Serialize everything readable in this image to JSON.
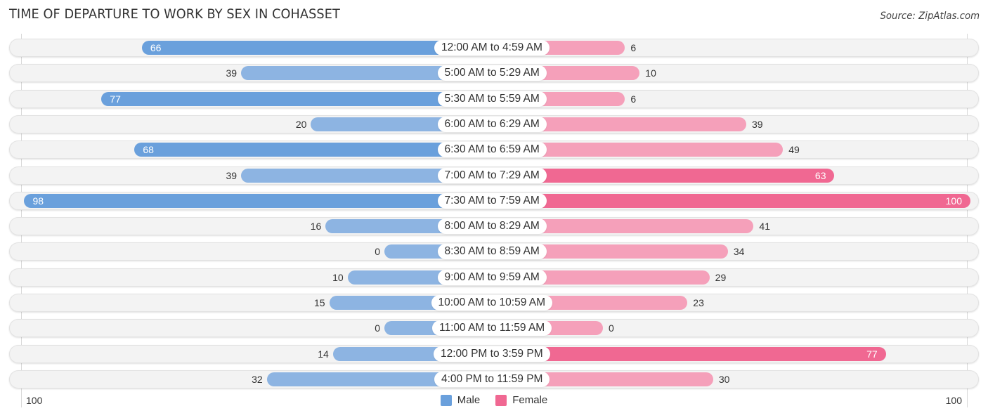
{
  "title": "TIME OF DEPARTURE TO WORK BY SEX IN COHASSET",
  "source": "Source: ZipAtlas.com",
  "colors": {
    "male": "#6aa0dc",
    "female": "#f06892",
    "male_light": "#8db4e2",
    "female_light": "#f5a0ba"
  },
  "chart_data": {
    "type": "bar",
    "orientation": "horizontal-diverging",
    "title": "TIME OF DEPARTURE TO WORK BY SEX IN COHASSET",
    "categories": [
      "12:00 AM to 4:59 AM",
      "5:00 AM to 5:29 AM",
      "5:30 AM to 5:59 AM",
      "6:00 AM to 6:29 AM",
      "6:30 AM to 6:59 AM",
      "7:00 AM to 7:29 AM",
      "7:30 AM to 7:59 AM",
      "8:00 AM to 8:29 AM",
      "8:30 AM to 8:59 AM",
      "9:00 AM to 9:59 AM",
      "10:00 AM to 10:59 AM",
      "11:00 AM to 11:59 AM",
      "12:00 PM to 3:59 PM",
      "4:00 PM to 11:59 PM"
    ],
    "series": [
      {
        "name": "Male",
        "values": [
          66,
          39,
          77,
          20,
          68,
          39,
          98,
          16,
          0,
          10,
          15,
          0,
          14,
          32
        ]
      },
      {
        "name": "Female",
        "values": [
          6,
          10,
          6,
          39,
          49,
          63,
          100,
          41,
          34,
          29,
          23,
          0,
          77,
          30
        ]
      }
    ],
    "xlim": [
      100,
      100
    ],
    "axis_tick_left": "100",
    "axis_tick_right": "100",
    "legend": [
      "Male",
      "Female"
    ],
    "legend_position": "bottom-center",
    "grid": false
  }
}
